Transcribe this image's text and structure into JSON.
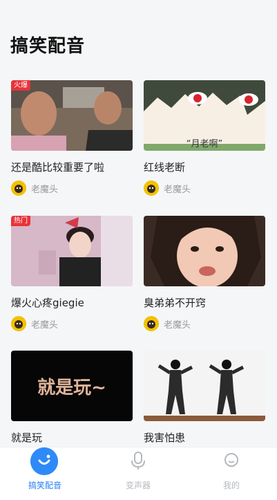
{
  "page": {
    "title": "搞笑配音"
  },
  "cards": [
    {
      "title": "还是酷比较重要了啦",
      "author": "老魔头",
      "tag": "火爆"
    },
    {
      "title": "红线老断",
      "author": "老魔头",
      "tag": "",
      "thumb_caption": "“月老啊”"
    },
    {
      "title": "爆火心疼giegie",
      "author": "老魔头",
      "tag": "热门"
    },
    {
      "title": "臭弟弟不开窍",
      "author": "老魔头",
      "tag": ""
    },
    {
      "title": "就是玩",
      "author": "",
      "tag": "",
      "thumb_caption": "就是玩~"
    },
    {
      "title": "我害怕患",
      "author": "",
      "tag": ""
    }
  ],
  "tabs": [
    {
      "label": "搞笑配音",
      "icon": "smile-icon",
      "active": true
    },
    {
      "label": "变声器",
      "icon": "microphone-icon",
      "active": false
    },
    {
      "label": "我的",
      "icon": "profile-icon",
      "active": false
    }
  ],
  "colors": {
    "accent": "#2e8af8",
    "tag_red": "#e8333a",
    "avatar_yellow": "#f2c200"
  }
}
